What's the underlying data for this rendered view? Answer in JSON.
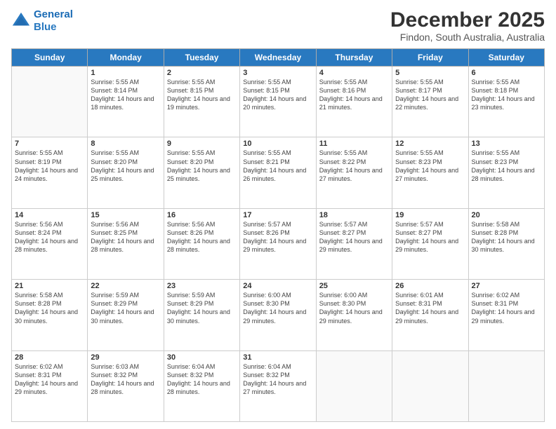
{
  "logo": {
    "line1": "General",
    "line2": "Blue"
  },
  "title": "December 2025",
  "subtitle": "Findon, South Australia, Australia",
  "days": [
    "Sunday",
    "Monday",
    "Tuesday",
    "Wednesday",
    "Thursday",
    "Friday",
    "Saturday"
  ],
  "weeks": [
    [
      {
        "day": "",
        "sunrise": "",
        "sunset": "",
        "daylight": ""
      },
      {
        "day": "1",
        "sunrise": "Sunrise: 5:55 AM",
        "sunset": "Sunset: 8:14 PM",
        "daylight": "Daylight: 14 hours and 18 minutes."
      },
      {
        "day": "2",
        "sunrise": "Sunrise: 5:55 AM",
        "sunset": "Sunset: 8:15 PM",
        "daylight": "Daylight: 14 hours and 19 minutes."
      },
      {
        "day": "3",
        "sunrise": "Sunrise: 5:55 AM",
        "sunset": "Sunset: 8:15 PM",
        "daylight": "Daylight: 14 hours and 20 minutes."
      },
      {
        "day": "4",
        "sunrise": "Sunrise: 5:55 AM",
        "sunset": "Sunset: 8:16 PM",
        "daylight": "Daylight: 14 hours and 21 minutes."
      },
      {
        "day": "5",
        "sunrise": "Sunrise: 5:55 AM",
        "sunset": "Sunset: 8:17 PM",
        "daylight": "Daylight: 14 hours and 22 minutes."
      },
      {
        "day": "6",
        "sunrise": "Sunrise: 5:55 AM",
        "sunset": "Sunset: 8:18 PM",
        "daylight": "Daylight: 14 hours and 23 minutes."
      }
    ],
    [
      {
        "day": "7",
        "sunrise": "Sunrise: 5:55 AM",
        "sunset": "Sunset: 8:19 PM",
        "daylight": "Daylight: 14 hours and 24 minutes."
      },
      {
        "day": "8",
        "sunrise": "Sunrise: 5:55 AM",
        "sunset": "Sunset: 8:20 PM",
        "daylight": "Daylight: 14 hours and 25 minutes."
      },
      {
        "day": "9",
        "sunrise": "Sunrise: 5:55 AM",
        "sunset": "Sunset: 8:20 PM",
        "daylight": "Daylight: 14 hours and 25 minutes."
      },
      {
        "day": "10",
        "sunrise": "Sunrise: 5:55 AM",
        "sunset": "Sunset: 8:21 PM",
        "daylight": "Daylight: 14 hours and 26 minutes."
      },
      {
        "day": "11",
        "sunrise": "Sunrise: 5:55 AM",
        "sunset": "Sunset: 8:22 PM",
        "daylight": "Daylight: 14 hours and 27 minutes."
      },
      {
        "day": "12",
        "sunrise": "Sunrise: 5:55 AM",
        "sunset": "Sunset: 8:23 PM",
        "daylight": "Daylight: 14 hours and 27 minutes."
      },
      {
        "day": "13",
        "sunrise": "Sunrise: 5:55 AM",
        "sunset": "Sunset: 8:23 PM",
        "daylight": "Daylight: 14 hours and 28 minutes."
      }
    ],
    [
      {
        "day": "14",
        "sunrise": "Sunrise: 5:56 AM",
        "sunset": "Sunset: 8:24 PM",
        "daylight": "Daylight: 14 hours and 28 minutes."
      },
      {
        "day": "15",
        "sunrise": "Sunrise: 5:56 AM",
        "sunset": "Sunset: 8:25 PM",
        "daylight": "Daylight: 14 hours and 28 minutes."
      },
      {
        "day": "16",
        "sunrise": "Sunrise: 5:56 AM",
        "sunset": "Sunset: 8:26 PM",
        "daylight": "Daylight: 14 hours and 28 minutes."
      },
      {
        "day": "17",
        "sunrise": "Sunrise: 5:57 AM",
        "sunset": "Sunset: 8:26 PM",
        "daylight": "Daylight: 14 hours and 29 minutes."
      },
      {
        "day": "18",
        "sunrise": "Sunrise: 5:57 AM",
        "sunset": "Sunset: 8:27 PM",
        "daylight": "Daylight: 14 hours and 29 minutes."
      },
      {
        "day": "19",
        "sunrise": "Sunrise: 5:57 AM",
        "sunset": "Sunset: 8:27 PM",
        "daylight": "Daylight: 14 hours and 29 minutes."
      },
      {
        "day": "20",
        "sunrise": "Sunrise: 5:58 AM",
        "sunset": "Sunset: 8:28 PM",
        "daylight": "Daylight: 14 hours and 30 minutes."
      }
    ],
    [
      {
        "day": "21",
        "sunrise": "Sunrise: 5:58 AM",
        "sunset": "Sunset: 8:28 PM",
        "daylight": "Daylight: 14 hours and 30 minutes."
      },
      {
        "day": "22",
        "sunrise": "Sunrise: 5:59 AM",
        "sunset": "Sunset: 8:29 PM",
        "daylight": "Daylight: 14 hours and 30 minutes."
      },
      {
        "day": "23",
        "sunrise": "Sunrise: 5:59 AM",
        "sunset": "Sunset: 8:29 PM",
        "daylight": "Daylight: 14 hours and 30 minutes."
      },
      {
        "day": "24",
        "sunrise": "Sunrise: 6:00 AM",
        "sunset": "Sunset: 8:30 PM",
        "daylight": "Daylight: 14 hours and 29 minutes."
      },
      {
        "day": "25",
        "sunrise": "Sunrise: 6:00 AM",
        "sunset": "Sunset: 8:30 PM",
        "daylight": "Daylight: 14 hours and 29 minutes."
      },
      {
        "day": "26",
        "sunrise": "Sunrise: 6:01 AM",
        "sunset": "Sunset: 8:31 PM",
        "daylight": "Daylight: 14 hours and 29 minutes."
      },
      {
        "day": "27",
        "sunrise": "Sunrise: 6:02 AM",
        "sunset": "Sunset: 8:31 PM",
        "daylight": "Daylight: 14 hours and 29 minutes."
      }
    ],
    [
      {
        "day": "28",
        "sunrise": "Sunrise: 6:02 AM",
        "sunset": "Sunset: 8:31 PM",
        "daylight": "Daylight: 14 hours and 29 minutes."
      },
      {
        "day": "29",
        "sunrise": "Sunrise: 6:03 AM",
        "sunset": "Sunset: 8:32 PM",
        "daylight": "Daylight: 14 hours and 28 minutes."
      },
      {
        "day": "30",
        "sunrise": "Sunrise: 6:04 AM",
        "sunset": "Sunset: 8:32 PM",
        "daylight": "Daylight: 14 hours and 28 minutes."
      },
      {
        "day": "31",
        "sunrise": "Sunrise: 6:04 AM",
        "sunset": "Sunset: 8:32 PM",
        "daylight": "Daylight: 14 hours and 27 minutes."
      },
      {
        "day": "",
        "sunrise": "",
        "sunset": "",
        "daylight": ""
      },
      {
        "day": "",
        "sunrise": "",
        "sunset": "",
        "daylight": ""
      },
      {
        "day": "",
        "sunrise": "",
        "sunset": "",
        "daylight": ""
      }
    ]
  ]
}
